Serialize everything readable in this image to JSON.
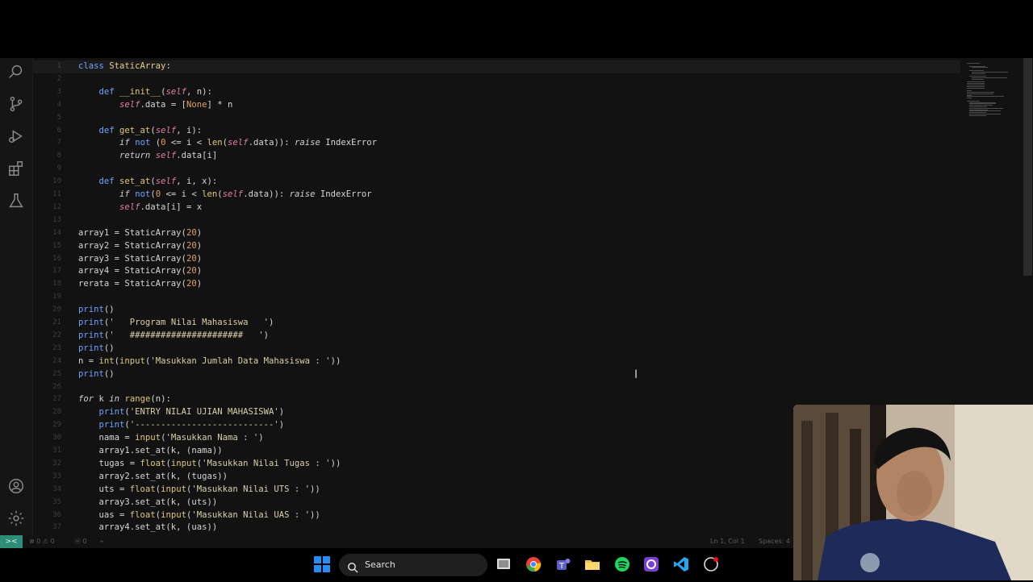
{
  "editor": {
    "lines": [
      {
        "n": "1",
        "html": "<span class='kw'>class</span> <span class='cls'>StaticArray</span>:"
      },
      {
        "n": "2",
        "html": ""
      },
      {
        "n": "3",
        "html": "    <span class='kw'>def</span> <span class='fn'>__init__</span>(<span class='slf'>self</span>, n):"
      },
      {
        "n": "4",
        "html": "        <span class='slf'>self</span>.data = [<span class='num'>None</span>] * n"
      },
      {
        "n": "5",
        "html": ""
      },
      {
        "n": "6",
        "html": "    <span class='kw'>def</span> <span class='fn'>get_at</span>(<span class='slf'>self</span>, i):"
      },
      {
        "n": "7",
        "html": "        <span class='it'>if</span> <span class='kw'>not</span> (<span class='num'>0</span> &lt;= i &lt; <span class='fn'>len</span>(<span class='slf'>self</span>.data)): <span class='it'>raise</span> IndexError"
      },
      {
        "n": "8",
        "html": "        <span class='it'>return</span> <span class='slf'>self</span>.data[i]"
      },
      {
        "n": "9",
        "html": ""
      },
      {
        "n": "10",
        "html": "    <span class='kw'>def</span> <span class='fn'>set_at</span>(<span class='slf'>self</span>, i, x):"
      },
      {
        "n": "11",
        "html": "        <span class='it'>if</span> <span class='kw'>not</span>(<span class='num'>0</span> &lt;= i &lt; <span class='fn'>len</span>(<span class='slf'>self</span>.data)): <span class='it'>raise</span> IndexError"
      },
      {
        "n": "12",
        "html": "        <span class='slf'>self</span>.data[i] = x"
      },
      {
        "n": "13",
        "html": ""
      },
      {
        "n": "14",
        "html": "array1 = StaticArray(<span class='num'>20</span>)"
      },
      {
        "n": "15",
        "html": "array2 = StaticArray(<span class='num'>20</span>)"
      },
      {
        "n": "16",
        "html": "array3 = StaticArray(<span class='num'>20</span>)"
      },
      {
        "n": "17",
        "html": "array4 = StaticArray(<span class='num'>20</span>)"
      },
      {
        "n": "18",
        "html": "rerata = StaticArray(<span class='num'>20</span>)"
      },
      {
        "n": "19",
        "html": ""
      },
      {
        "n": "20",
        "html": "<span class='kw'>print</span>()"
      },
      {
        "n": "21",
        "html": "<span class='kw'>print</span>(<span class='str'>'   Program Nilai Mahasiswa   '</span>)"
      },
      {
        "n": "22",
        "html": "<span class='kw'>print</span>(<span class='str'>'   ######################   '</span>)"
      },
      {
        "n": "23",
        "html": "<span class='kw'>print</span>()"
      },
      {
        "n": "24",
        "html": "n = <span class='fn'>int</span>(<span class='fn'>input</span>(<span class='str'>'Masukkan Jumlah Data Mahasiswa : '</span>))"
      },
      {
        "n": "25",
        "html": "<span class='kw'>print</span>()"
      },
      {
        "n": "26",
        "html": ""
      },
      {
        "n": "27",
        "html": "<span class='it'>for</span> k <span class='it'>in</span> <span class='fn'>range</span>(n):"
      },
      {
        "n": "28",
        "html": "    <span class='kw'>print</span>(<span class='str'>'ENTRY NILAI UJIAN MAHASISWA'</span>)"
      },
      {
        "n": "29",
        "html": "    <span class='kw'>print</span>(<span class='str'>'---------------------------'</span>)"
      },
      {
        "n": "30",
        "html": "    nama = <span class='fn'>input</span>(<span class='str'>'Masukkan Nama : '</span>)"
      },
      {
        "n": "31",
        "html": "    array1.set_at(k, (nama))"
      },
      {
        "n": "32",
        "html": "    tugas = <span class='fn'>float</span>(<span class='fn'>input</span>(<span class='str'>'Masukkan Nilai Tugas : '</span>))"
      },
      {
        "n": "33",
        "html": "    array2.set_at(k, (tugas))"
      },
      {
        "n": "34",
        "html": "    uts = <span class='fn'>float</span>(<span class='fn'>input</span>(<span class='str'>'Masukkan Nilai UTS : '</span>))"
      },
      {
        "n": "35",
        "html": "    array3.set_at(k, (uts))"
      },
      {
        "n": "36",
        "html": "    uas = <span class='fn'>float</span>(<span class='fn'>input</span>(<span class='str'>'Masukkan Nilai UAS : '</span>))"
      },
      {
        "n": "37",
        "html": "    array4.set_at(k, (uas))"
      }
    ]
  },
  "statusbar": {
    "errors": "0",
    "warnings": "0",
    "ports": "0",
    "position": "Ln 1, Col 1",
    "spaces": "Spaces: 4"
  },
  "taskbar": {
    "search_placeholder": "Search"
  },
  "colors": {
    "accent_remote": "#2f8c76",
    "editor_bg": "#121212"
  }
}
